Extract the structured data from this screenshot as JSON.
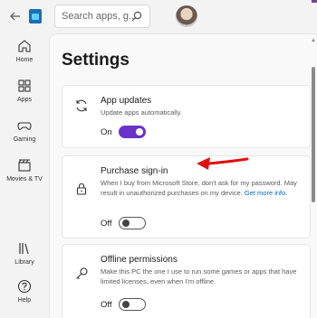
{
  "header": {
    "search_placeholder": "Search apps, g...",
    "icons": [
      "back-arrow-icon",
      "store-logo-icon",
      "search-icon",
      "avatar"
    ]
  },
  "sidebar": {
    "items": [
      {
        "label": "Home",
        "icon": "home-icon"
      },
      {
        "label": "Apps",
        "icon": "apps-icon"
      },
      {
        "label": "Gaming",
        "icon": "gaming-icon"
      },
      {
        "label": "Movies & TV",
        "icon": "movies-icon"
      },
      {
        "label": "Library",
        "icon": "library-icon"
      },
      {
        "label": "Help",
        "icon": "help-icon"
      }
    ]
  },
  "page": {
    "title": "Settings"
  },
  "settings": [
    {
      "title": "App updates",
      "description": "Update apps automatically.",
      "toggle_label": "On",
      "toggle_state": "on",
      "icon": "refresh-icon"
    },
    {
      "title": "Purchase sign-in",
      "description": "When I buy from Microsoft Store, don't ask for my password. May result in unauthorized purchases on my device.",
      "link_text": "Get more info.",
      "toggle_label": "Off",
      "toggle_state": "off",
      "icon": "lock-icon"
    },
    {
      "title": "Offline permissions",
      "description": "Make this PC the one I use to run some games or apps that have limited licenses, even when I'm offline.",
      "toggle_label": "Off",
      "toggle_state": "off",
      "icon": "key-icon"
    }
  ],
  "colors": {
    "accent": "#6b32c9",
    "annotation_arrow": "#e01010",
    "link": "#0067c0"
  }
}
